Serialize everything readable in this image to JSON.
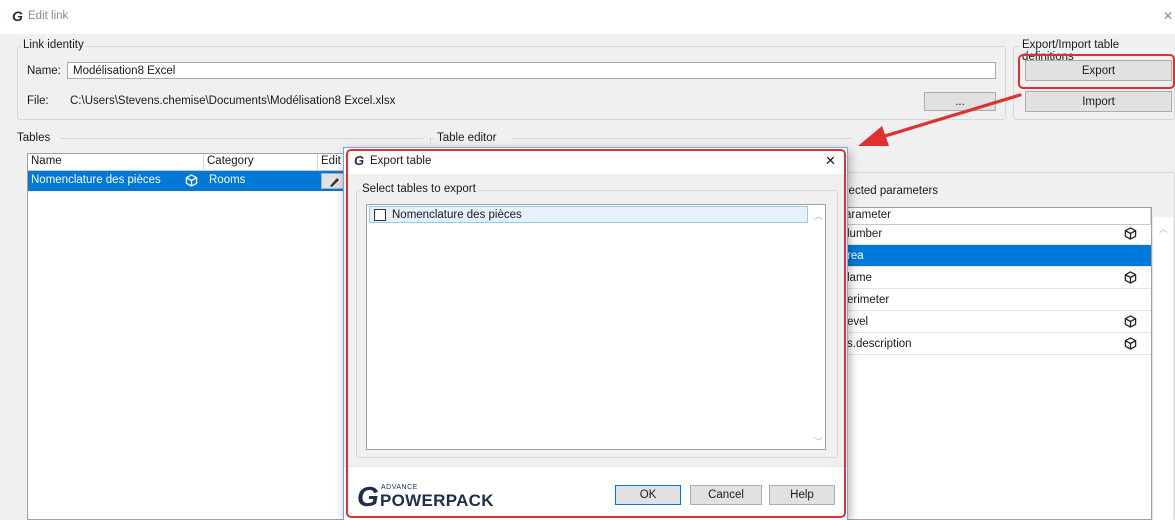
{
  "window": {
    "title": "Edit link",
    "close_glyph": "✕"
  },
  "link_identity": {
    "title": "Link identity",
    "name_label": "Name:",
    "name_value": "Modélisation8 Excel",
    "file_label": "File:",
    "file_value": "C:\\Users\\Stevens.chemise\\Documents\\Modélisation8 Excel.xlsx",
    "browse_label": "..."
  },
  "export_import": {
    "title": "Export/Import table definitions",
    "export_label": "Export",
    "import_label": "Import"
  },
  "tables": {
    "title": "Tables",
    "columns": [
      "Name",
      "Category",
      "Edit"
    ],
    "rows": [
      {
        "name": "Nomenclature des pièces",
        "category": "Rooms"
      }
    ]
  },
  "table_editor": {
    "title": "Table editor",
    "selected_params_title": "lected parameters",
    "param_header": "arameter",
    "params": [
      {
        "name": "lumber",
        "icon": true,
        "selected": false
      },
      {
        "name": "rea",
        "icon": false,
        "selected": true
      },
      {
        "name": "lame",
        "icon": true,
        "selected": false
      },
      {
        "name": "erimeter",
        "icon": false,
        "selected": false
      },
      {
        "name": "evel",
        "icon": true,
        "selected": false
      },
      {
        "name": "s.description",
        "icon": true,
        "selected": false
      }
    ]
  },
  "export_dialog": {
    "title": "Export table",
    "close_glyph": "✕",
    "group_title": "Select tables to export",
    "items": [
      {
        "label": "Nomenclature des pièces",
        "checked": false
      }
    ],
    "brand_small": "ADVANCE",
    "brand_large": "POWERPACK",
    "ok_label": "OK",
    "cancel_label": "Cancel",
    "help_label": "Help"
  },
  "colors": {
    "selection": "#0078d7",
    "highlight": "#e03131",
    "brand": "#1e2d4a"
  }
}
